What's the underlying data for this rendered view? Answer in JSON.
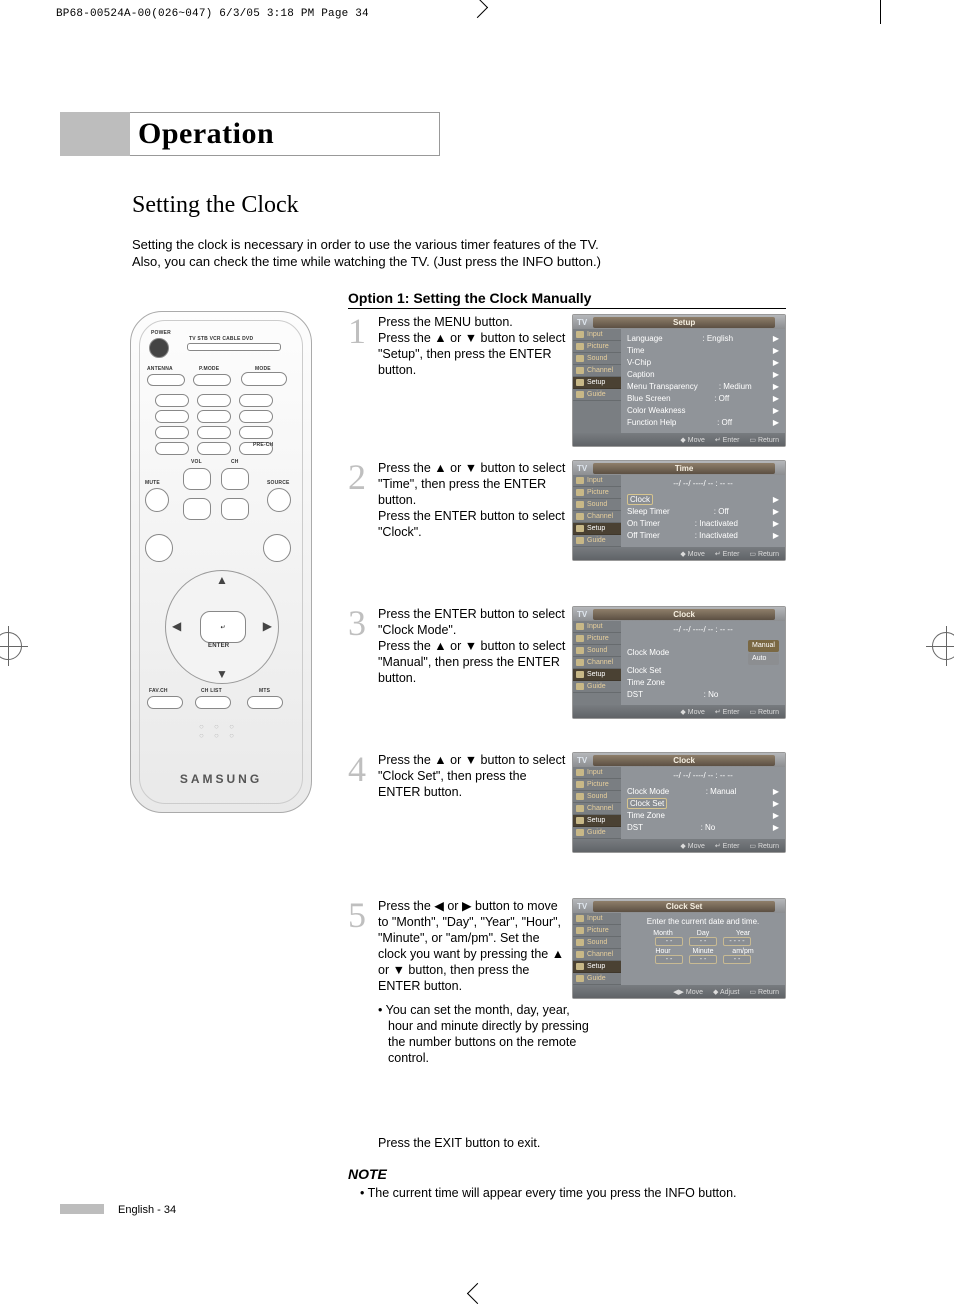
{
  "header_line": "BP68-00524A-00(026~047)  6/3/05  3:18 PM  Page 34",
  "section_title": "Operation",
  "h2": "Setting the Clock",
  "intro1": "Setting the clock is necessary in order to use the various timer features of the TV.",
  "intro2": "Also, you can check the time while watching the TV. (Just press the INFO button.)",
  "option_title": "Option 1: Setting the Clock Manually",
  "remote": {
    "power": "POWER",
    "modes": "TV  STB  VCR  CABLE  DVD",
    "antenna": "ANTENNA",
    "pmode": "P.MODE",
    "mode": "MODE",
    "vol": "VOL",
    "ch": "CH",
    "mute": "MUTE",
    "source": "SOURCE",
    "prech": "PRE-CH",
    "enter": "ENTER",
    "favch": "FAV.CH",
    "chlist": "CH LIST",
    "mts": "MTS",
    "brand": "SAMSUNG"
  },
  "steps": [
    {
      "n": "1",
      "text": "Press the MENU button.\nPress the ▲ or ▼ button to select \"Setup\", then press the ENTER button."
    },
    {
      "n": "2",
      "text": "Press the ▲ or ▼ button to select \"Time\", then press the ENTER button.\nPress the ENTER button to select \"Clock\"."
    },
    {
      "n": "3",
      "text": "Press the ENTER button to select \"Clock Mode\".\nPress the ▲ or ▼ button to select \"Manual\", then press the ENTER button."
    },
    {
      "n": "4",
      "text": "Press the ▲ or ▼ button to select \"Clock Set\", then press the ENTER button."
    },
    {
      "n": "5",
      "text": "Press the ◀ or ▶ button to move to \"Month\", \"Day\", \"Year\", \"Hour\", \"Minute\", or \"am/pm\". Set the clock you want by pressing the ▲ or ▼ button, then press the ENTER button.",
      "bullet": "•  You can set the month, day, year, hour and minute directly by pressing the number buttons on the remote control."
    }
  ],
  "osd_side": [
    "Input",
    "Picture",
    "Sound",
    "Channel",
    "Setup",
    "Guide"
  ],
  "foot_std": {
    "move": "Move",
    "enter": "Enter",
    "return": "Return"
  },
  "foot_set": {
    "move": "Move",
    "adjust": "Adjust",
    "return": "Return"
  },
  "osd1": {
    "title": "Setup",
    "rows": [
      {
        "k": "Language",
        "v": ": English",
        "a": "▶"
      },
      {
        "k": "Time",
        "v": "",
        "a": "▶"
      },
      {
        "k": "V-Chip",
        "v": "",
        "a": "▶"
      },
      {
        "k": "Caption",
        "v": "",
        "a": "▶"
      },
      {
        "k": "Menu Transparency",
        "v": ": Medium",
        "a": "▶"
      },
      {
        "k": "Blue Screen",
        "v": ": Off",
        "a": "▶"
      },
      {
        "k": "Color Weakness",
        "v": "",
        "a": "▶"
      },
      {
        "k": "Function Help",
        "v": ": Off",
        "a": "▶"
      }
    ]
  },
  "osd2": {
    "title": "Time",
    "date": "--/ --/ ----/ -- : -- --",
    "rows": [
      {
        "k": "Clock",
        "v": "",
        "a": "▶",
        "hl": true
      },
      {
        "k": "Sleep Timer",
        "v": ": Off",
        "a": "▶"
      },
      {
        "k": "On Timer",
        "v": ": Inactivated",
        "a": "▶"
      },
      {
        "k": "Off Timer",
        "v": ": Inactivated",
        "a": "▶"
      }
    ]
  },
  "osd3": {
    "title": "Clock",
    "date": "--/ --/ ----/ -- : -- --",
    "rows": [
      {
        "k": "Clock Mode",
        "opts": [
          "Manual",
          "Auto"
        ],
        "sel": 0
      },
      {
        "k": "Clock Set",
        "v": "",
        "a": ""
      },
      {
        "k": "Time Zone",
        "v": "",
        "a": ""
      },
      {
        "k": "DST",
        "v": ": No",
        "a": ""
      }
    ]
  },
  "osd4": {
    "title": "Clock",
    "date": "--/ --/ ----/ -- : -- --",
    "rows": [
      {
        "k": "Clock Mode",
        "v": ": Manual",
        "a": "▶"
      },
      {
        "k": "Clock Set",
        "v": "",
        "a": "▶",
        "hl": true
      },
      {
        "k": "Time Zone",
        "v": "",
        "a": "▶"
      },
      {
        "k": "DST",
        "v": ": No",
        "a": "▶"
      }
    ]
  },
  "osd5": {
    "title": "Clock Set",
    "prompt": "Enter the current date and time.",
    "labels1": [
      "Month",
      "Day",
      "Year"
    ],
    "vals1": [
      "- -",
      "- -",
      "- - - -"
    ],
    "labels2": [
      "Hour",
      "Minute",
      "am/pm"
    ],
    "vals2": [
      "- -",
      "- -",
      "- -"
    ]
  },
  "exit_line": "Press the EXIT button to exit.",
  "note_h": "NOTE",
  "note_body": "•   The current time will appear every time you press the INFO button.",
  "footer": "English - 34"
}
